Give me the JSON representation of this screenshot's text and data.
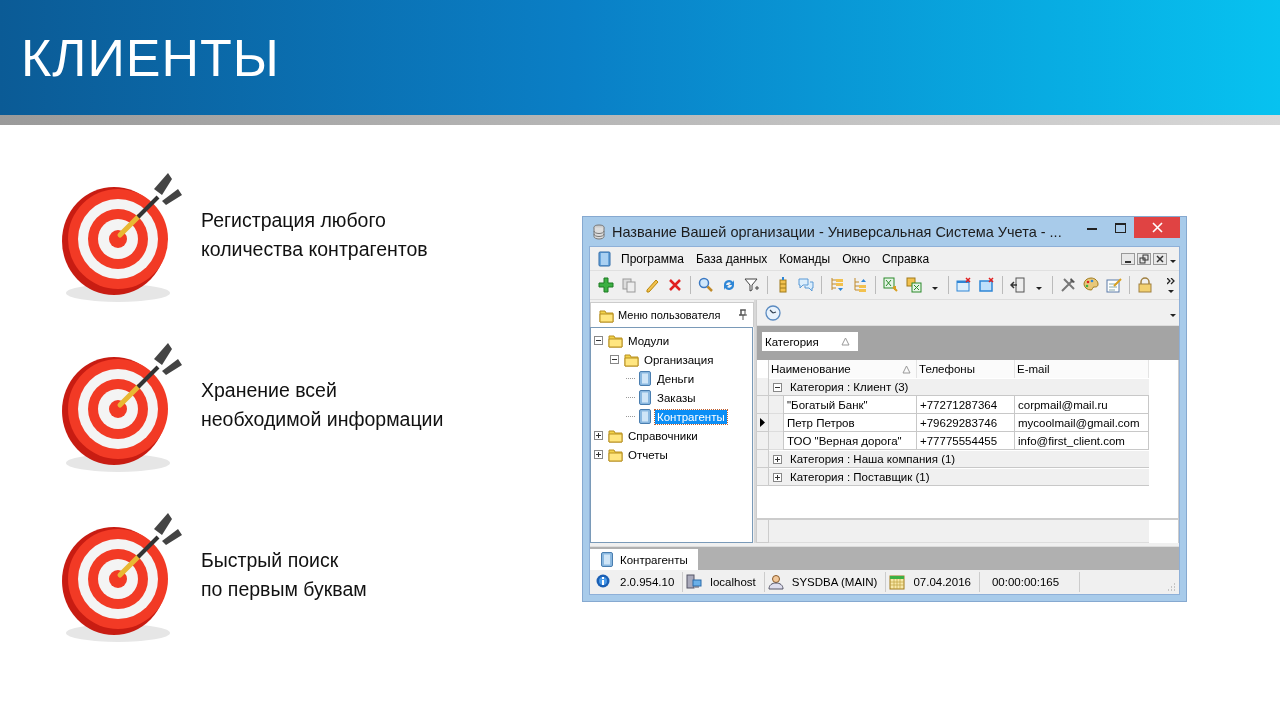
{
  "header": {
    "title": "КЛИЕНТЫ"
  },
  "features": [
    {
      "lines": [
        "Регистрация любого",
        "количества контрагентов"
      ]
    },
    {
      "lines": [
        "Хранение всей",
        "необходимой информации"
      ]
    },
    {
      "lines": [
        "Быстрый поиск",
        "по первым буквам"
      ]
    }
  ],
  "window": {
    "title": "Название Вашей организации - Универсальная Система Учета - ...",
    "menu": [
      "Программа",
      "База данных",
      "Команды",
      "Окно",
      "Справка"
    ],
    "nav_panel": {
      "title": "Меню пользователя",
      "tree": [
        {
          "label": "Модули",
          "kind": "folder",
          "expanded": true,
          "selected": false,
          "children": [
            {
              "label": "Организация",
              "kind": "folder",
              "expanded": true,
              "selected": false,
              "children": [
                {
                  "label": "Деньги",
                  "kind": "document",
                  "selected": false
                },
                {
                  "label": "Заказы",
                  "kind": "document",
                  "selected": false
                },
                {
                  "label": "Контрагенты",
                  "kind": "document",
                  "selected": true
                }
              ]
            }
          ]
        },
        {
          "label": "Справочники",
          "kind": "folder",
          "expanded": false,
          "selected": false
        },
        {
          "label": "Отчеты",
          "kind": "folder",
          "expanded": false,
          "selected": false
        }
      ]
    },
    "grid": {
      "group_by": "Категория",
      "columns": [
        "Наименование",
        "Телефоны",
        "E-mail"
      ],
      "groups": [
        {
          "label": "Категория : Клиент (3)",
          "expanded": true,
          "rows": [
            {
              "current": false,
              "cells": [
                "\"Богатый Банк\"",
                "+77271287364",
                "corpmail@mail.ru"
              ]
            },
            {
              "current": true,
              "cells": [
                "Петр Петров",
                "+79629283746",
                "mycoolmail@gmail.com"
              ]
            },
            {
              "current": false,
              "cells": [
                "ТОО \"Верная дорога\"",
                "+77775554455",
                "info@first_client.com"
              ]
            }
          ]
        },
        {
          "label": "Категория : Наша компания (1)",
          "expanded": false
        },
        {
          "label": "Категория : Поставщик (1)",
          "expanded": false
        }
      ]
    },
    "document_tabs": [
      {
        "label": "Контрагенты",
        "selected": true
      }
    ],
    "status_bar": [
      {
        "kind": "version",
        "text": "2.0.954.10"
      },
      {
        "kind": "server",
        "text": "localhost"
      },
      {
        "kind": "user",
        "text": "SYSDBA (MAIN)"
      },
      {
        "kind": "date",
        "text": "07.04.2016"
      },
      {
        "kind": "timer",
        "text": "00:00:00:165"
      }
    ]
  }
}
